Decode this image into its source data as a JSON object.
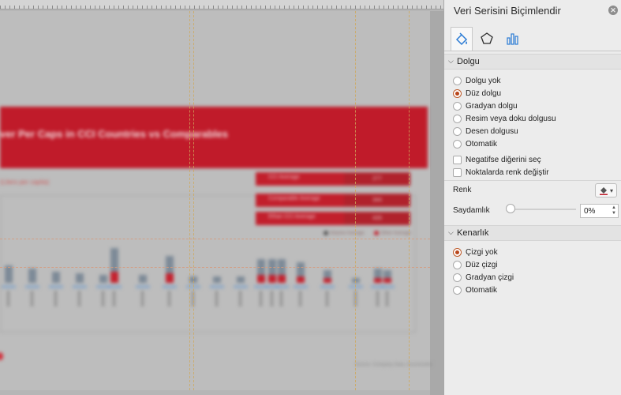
{
  "slide": {
    "title": "ver Per Caps in CCI Countries vs Comparables",
    "subtitle_note": "(Liters per capita)",
    "stats": [
      {
        "label": "CCI Average",
        "value": "277"
      },
      {
        "label": "Comparable Average",
        "value": "344"
      },
      {
        "label": "Ethan CCI Average",
        "value": "426"
      }
    ],
    "legend": [
      "Volume Average",
      "Other Average"
    ],
    "footer_note": "Source: Company Data, Euromonitor"
  },
  "panel": {
    "title": "Veri Serisini Biçimlendir",
    "close_icon": "close-icon",
    "tabs": [
      {
        "name": "fill-line-tab",
        "icon": "paint-bucket-icon",
        "active": true
      },
      {
        "name": "effects-tab",
        "icon": "pentagon-icon",
        "active": false
      },
      {
        "name": "series-options-tab",
        "icon": "bar-chart-icon",
        "active": false
      }
    ],
    "fill_section": {
      "label": "Dolgu",
      "options": [
        {
          "label": "Dolgu yok",
          "selected": false
        },
        {
          "label": "Düz dolgu",
          "selected": true
        },
        {
          "label": "Gradyan dolgu",
          "selected": false
        },
        {
          "label": "Resim veya doku dolgusu",
          "selected": false
        },
        {
          "label": "Desen dolgusu",
          "selected": false
        },
        {
          "label": "Otomatik",
          "selected": false
        }
      ],
      "checkboxes": [
        {
          "label": "Negatifse diğerini seç",
          "checked": false
        },
        {
          "label": "Noktalarda renk değiştir",
          "checked": false
        }
      ],
      "color_label": "Renk",
      "transparency_label": "Saydamlık",
      "transparency_value": "0%"
    },
    "border_section": {
      "label": "Kenarlık",
      "options": [
        {
          "label": "Çizgi yok",
          "selected": true
        },
        {
          "label": "Düz çizgi",
          "selected": false
        },
        {
          "label": "Gradyan çizgi",
          "selected": false
        },
        {
          "label": "Otomatik",
          "selected": false
        }
      ]
    }
  },
  "colors": {
    "accent_red": "#c01b2a",
    "radio_selected": "#b8451a"
  }
}
